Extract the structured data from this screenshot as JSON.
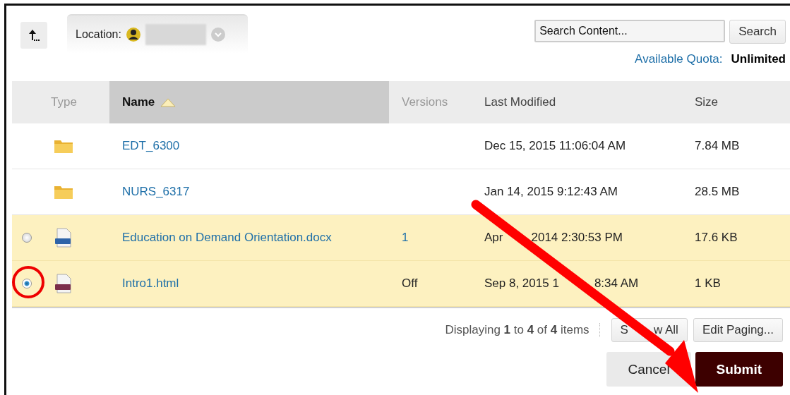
{
  "location": {
    "label": "Location:"
  },
  "search": {
    "placeholder": "Search Content...",
    "button": "Search"
  },
  "quota": {
    "label": "Available Quota:",
    "value": "Unlimited"
  },
  "table": {
    "columns": [
      {
        "label": "Type",
        "sorted": false,
        "active": false
      },
      {
        "label": "Name",
        "sorted": true,
        "active": true
      },
      {
        "label": "Versions",
        "sorted": false,
        "active": false
      },
      {
        "label": "Last Modified",
        "sorted": false,
        "active": true
      },
      {
        "label": "Size",
        "sorted": false,
        "active": true
      }
    ],
    "rows": [
      {
        "kind": "folder",
        "name": "EDT_6300",
        "modified": [
          "Dec 15, 2015 11:06:04 AM"
        ],
        "size": "7.84 MB",
        "highlighted": false
      },
      {
        "kind": "folder",
        "name": "NURS_6317",
        "modified": [
          "Jan 14, 2015 9:12:43 AM"
        ],
        "size": "28.5 MB",
        "highlighted": false
      },
      {
        "kind": "doc",
        "name": "Education on Demand Orientation.docx",
        "versions": "1",
        "modified": [
          "Apr",
          "2014 2:30:53 PM"
        ],
        "size": "17.6 KB",
        "highlighted": true,
        "selected": false
      },
      {
        "kind": "htm",
        "name": "Intro1.html",
        "versions": "Off",
        "modified": [
          "Sep 8, 2015 1",
          "8:34 AM"
        ],
        "size": "1 KB",
        "highlighted": true,
        "selected": true
      }
    ]
  },
  "paging": {
    "summary": "Displaying **1** to **4** of **4** items",
    "buttons": [
      [
        "S",
        "w All"
      ],
      [
        "Edit Paging..."
      ]
    ]
  },
  "actions": [
    {
      "label": "Cancel",
      "kind": "secondary"
    },
    {
      "label": "Submit",
      "kind": "primary"
    }
  ],
  "highlight_circle": true,
  "pointer_arrow": true
}
